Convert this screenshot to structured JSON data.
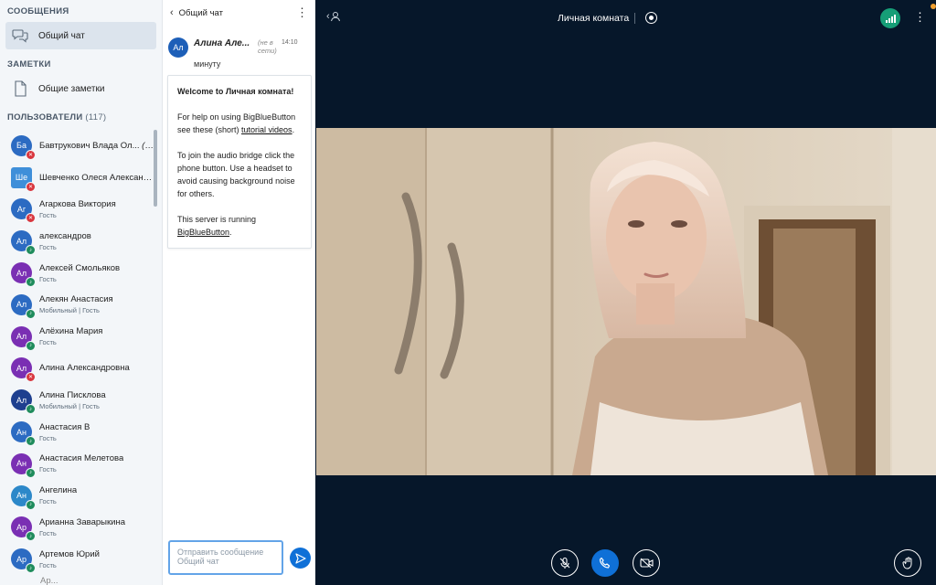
{
  "sidebar": {
    "messages_title": "СООБЩЕНИЯ",
    "public_chat_label": "Общий чат",
    "notes_title": "ЗАМЕТКИ",
    "shared_notes_label": "Общие заметки",
    "users_title": "ПОЛЬЗОВАТЕЛИ",
    "users_count": "(117)",
    "users": [
      {
        "initials": "Ба",
        "name": "Бавтрукович Влада Ол...",
        "you": "(Вы)",
        "role": "",
        "color": "#2C6BC2",
        "status": "muted"
      },
      {
        "initials": "Ше",
        "name": "Шевченко Олеся Александр...",
        "role": "",
        "color": "#3F8FD9",
        "status": "muted"
      },
      {
        "initials": "Аг",
        "name": "Агаркова Виктория",
        "role": "Гость",
        "color": "#2C6BC2",
        "status": "muted"
      },
      {
        "initials": "Ал",
        "name": "александров",
        "role": "Гость",
        "color": "#2C6BC2",
        "status": "listen"
      },
      {
        "initials": "Ал",
        "name": "Алексей Смольяков",
        "role": "Гость",
        "color": "#7A2FB3",
        "status": "listen"
      },
      {
        "initials": "Ал",
        "name": "Алекян Анастасия",
        "role": "Мобильный | Гость",
        "color": "#2C6BC2",
        "status": "listen"
      },
      {
        "initials": "Ал",
        "name": "Алёхина Мария",
        "role": "Гость",
        "color": "#7A2FB3",
        "status": "listen"
      },
      {
        "initials": "Ал",
        "name": "Алина Александровна",
        "role": "",
        "color": "#7A2FB3",
        "status": "muted"
      },
      {
        "initials": "Ал",
        "name": "Алина Писклова",
        "role": "Мобильный | Гость",
        "color": "#1E3F8F",
        "status": "listen"
      },
      {
        "initials": "Ан",
        "name": "Анастасия В",
        "role": "Гость",
        "color": "#2C6BC2",
        "status": "listen"
      },
      {
        "initials": "Ан",
        "name": "Анастасия Мелетова",
        "role": "Гость",
        "color": "#7A2FB3",
        "status": "listen"
      },
      {
        "initials": "Ан",
        "name": "Ангелина",
        "role": "Гость",
        "color": "#2C88C9",
        "status": "listen"
      },
      {
        "initials": "Ар",
        "name": "Арианна Заварыкина",
        "role": "Гость",
        "color": "#7A2FB3",
        "status": "listen"
      },
      {
        "initials": "Ар",
        "name": "Артемов Юрий",
        "role": "Гость",
        "color": "#2C6BC2",
        "status": "listen"
      }
    ],
    "partial_user": "Ар..."
  },
  "chat": {
    "header_title": "Общий чат",
    "message": {
      "initials": "Ал",
      "author": "Алина Але...",
      "offline": "(не в сети)",
      "time": "14:10",
      "text": "минуту",
      "avatar_color": "#1D5FB8"
    },
    "welcome": {
      "line1": "Welcome to Личная комната!",
      "line2_pre": "For help on using BigBlueButton see these (short) ",
      "line2_link": "tutorial videos",
      "line2_post": ".",
      "line3": "To join the audio bridge click the phone button. Use a headset to avoid causing background noise for others.",
      "line4_pre": "This server is running ",
      "line4_link": "BigBlueButton",
      "line4_post": "."
    },
    "input_placeholder": "Отправить сообщение Общий чат"
  },
  "main": {
    "room_title": "Личная комната"
  },
  "colors": {
    "primary": "#0F70D7",
    "background": "#06172A",
    "connection": "#169E77",
    "muted": "#D9363E",
    "listen": "#1F8C5C"
  },
  "icons": {
    "public_chat": "chat-bubbles-icon",
    "shared_notes": "document-icon",
    "mute": "microphone-muted-icon",
    "phone": "phone-icon",
    "video": "video-off-icon",
    "raise_hand": "hand-icon"
  }
}
